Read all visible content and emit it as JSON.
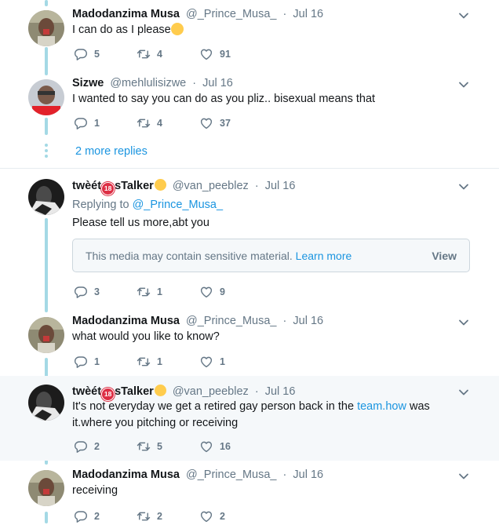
{
  "tweets": [
    {
      "name": "Madodanzima Musa",
      "handle": "@_Prince_Musa_",
      "dot": "·",
      "date": "Jul 16",
      "text": "I can do as I please",
      "replies": "5",
      "retweets": "4",
      "likes": "91"
    },
    {
      "name": "Sizwe",
      "handle": "@mehlulisizwe",
      "dot": "·",
      "date": "Jul 16",
      "text": "I wanted to say you can do as you pliz.. bisexual means that",
      "replies": "1",
      "retweets": "4",
      "likes": "37"
    },
    {
      "name_prefix": "twèét",
      "name_badge": "18",
      "name_suffix": "sTalker",
      "handle": "@van_peeblez",
      "dot": "·",
      "date": "Jul 16",
      "replying_prefix": "Replying to",
      "replying_handle": "@_Prince_Musa_",
      "text": "Please tell us more,abt you",
      "sensitive_message": "This media may contain sensitive material.",
      "sensitive_learn_more": "Learn more",
      "sensitive_view": "View",
      "replies": "3",
      "retweets": "1",
      "likes": "9"
    },
    {
      "name": "Madodanzima Musa",
      "handle": "@_Prince_Musa_",
      "dot": "·",
      "date": "Jul 16",
      "text": "what would you like to know?",
      "replies": "1",
      "retweets": "1",
      "likes": "1"
    },
    {
      "name_prefix": "twèét",
      "name_badge": "18",
      "name_suffix": "sTalker",
      "handle": "@van_peeblez",
      "dot": "·",
      "date": "Jul 16",
      "text_line1_prefix": "It's not everyday we get a retired gay person back in the ",
      "text_line1_link": "team.how",
      "text_line1_suffix": " was",
      "text_line2": "it.where you pitching or receiving",
      "replies": "2",
      "retweets": "5",
      "likes": "16"
    },
    {
      "name": "Madodanzima Musa",
      "handle": "@_Prince_Musa_",
      "dot": "·",
      "date": "Jul 16",
      "text": "receiving",
      "replies": "2",
      "retweets": "2",
      "likes": "2"
    }
  ],
  "more_replies": "2 more replies",
  "icons": {
    "reply": "reply-icon",
    "retweet": "retweet-icon",
    "like": "heart-icon",
    "menu": "chevron-down-icon"
  },
  "colors": {
    "thread_line": "#a4d9e5",
    "link": "#1b95e0",
    "muted": "#657786",
    "highlight_bg": "#f5f8fa"
  }
}
